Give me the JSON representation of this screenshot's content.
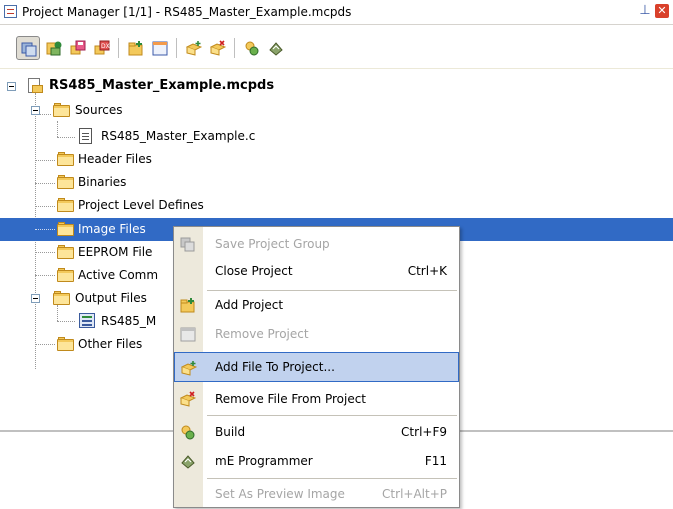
{
  "window": {
    "title": "Project Manager [1/1] - RS485_Master_Example.mcpds",
    "pin_icon": "pin-icon",
    "close_icon": "close-icon",
    "close_glyph": "✕",
    "pin_glyph": "⊥"
  },
  "toolbar": {
    "buttons": [
      {
        "name": "open-project-group-icon",
        "pressed": true
      },
      {
        "name": "new-project-group-icon"
      },
      {
        "name": "save-project-group-icon"
      },
      {
        "name": "close-project-group-icon"
      },
      {
        "name": "add-project-icon"
      },
      {
        "name": "remove-project-icon"
      },
      {
        "name": "add-file-icon"
      },
      {
        "name": "remove-file-icon"
      },
      {
        "name": "build-icon"
      },
      {
        "name": "programmer-icon"
      }
    ]
  },
  "tree": {
    "root": "RS485_Master_Example.mcpds",
    "sources": "Sources",
    "source_file": "RS485_Master_Example.c",
    "header_files": "Header Files",
    "binaries": "Binaries",
    "project_level_defines": "Project Level Defines",
    "image_files": "Image Files",
    "eeprom_files": "EEPROM File",
    "active_comments": "Active Comm",
    "output_files": "Output Files",
    "output_file": "RS485_M",
    "other_files": "Other Files"
  },
  "context_menu": {
    "items": [
      {
        "label": "Save Project Group",
        "shortcut": "",
        "enabled": false,
        "icon": "save-project-group-icon"
      },
      {
        "label": "Close Project",
        "shortcut": "Ctrl+K",
        "enabled": true,
        "icon": ""
      },
      {
        "label": "Add Project",
        "shortcut": "",
        "enabled": true,
        "icon": "add-project-icon"
      },
      {
        "label": "Remove Project",
        "shortcut": "",
        "enabled": false,
        "icon": "remove-project-icon"
      },
      {
        "label": "Add File To Project...",
        "shortcut": "",
        "enabled": true,
        "highlighted": true,
        "icon": "add-file-icon"
      },
      {
        "label": "Remove File From Project",
        "shortcut": "",
        "enabled": true,
        "icon": "remove-file-icon"
      },
      {
        "label": "Build",
        "shortcut": "Ctrl+F9",
        "enabled": true,
        "icon": "build-icon"
      },
      {
        "label": "mE Programmer",
        "shortcut": "F11",
        "enabled": true,
        "icon": "programmer-icon"
      },
      {
        "label": "Set As Preview Image",
        "shortcut": "Ctrl+Alt+P",
        "enabled": false,
        "icon": ""
      }
    ]
  },
  "colors": {
    "selection": "#316ac5",
    "menu_highlight": "#c1d2ee",
    "folder": "#f3c95b"
  }
}
